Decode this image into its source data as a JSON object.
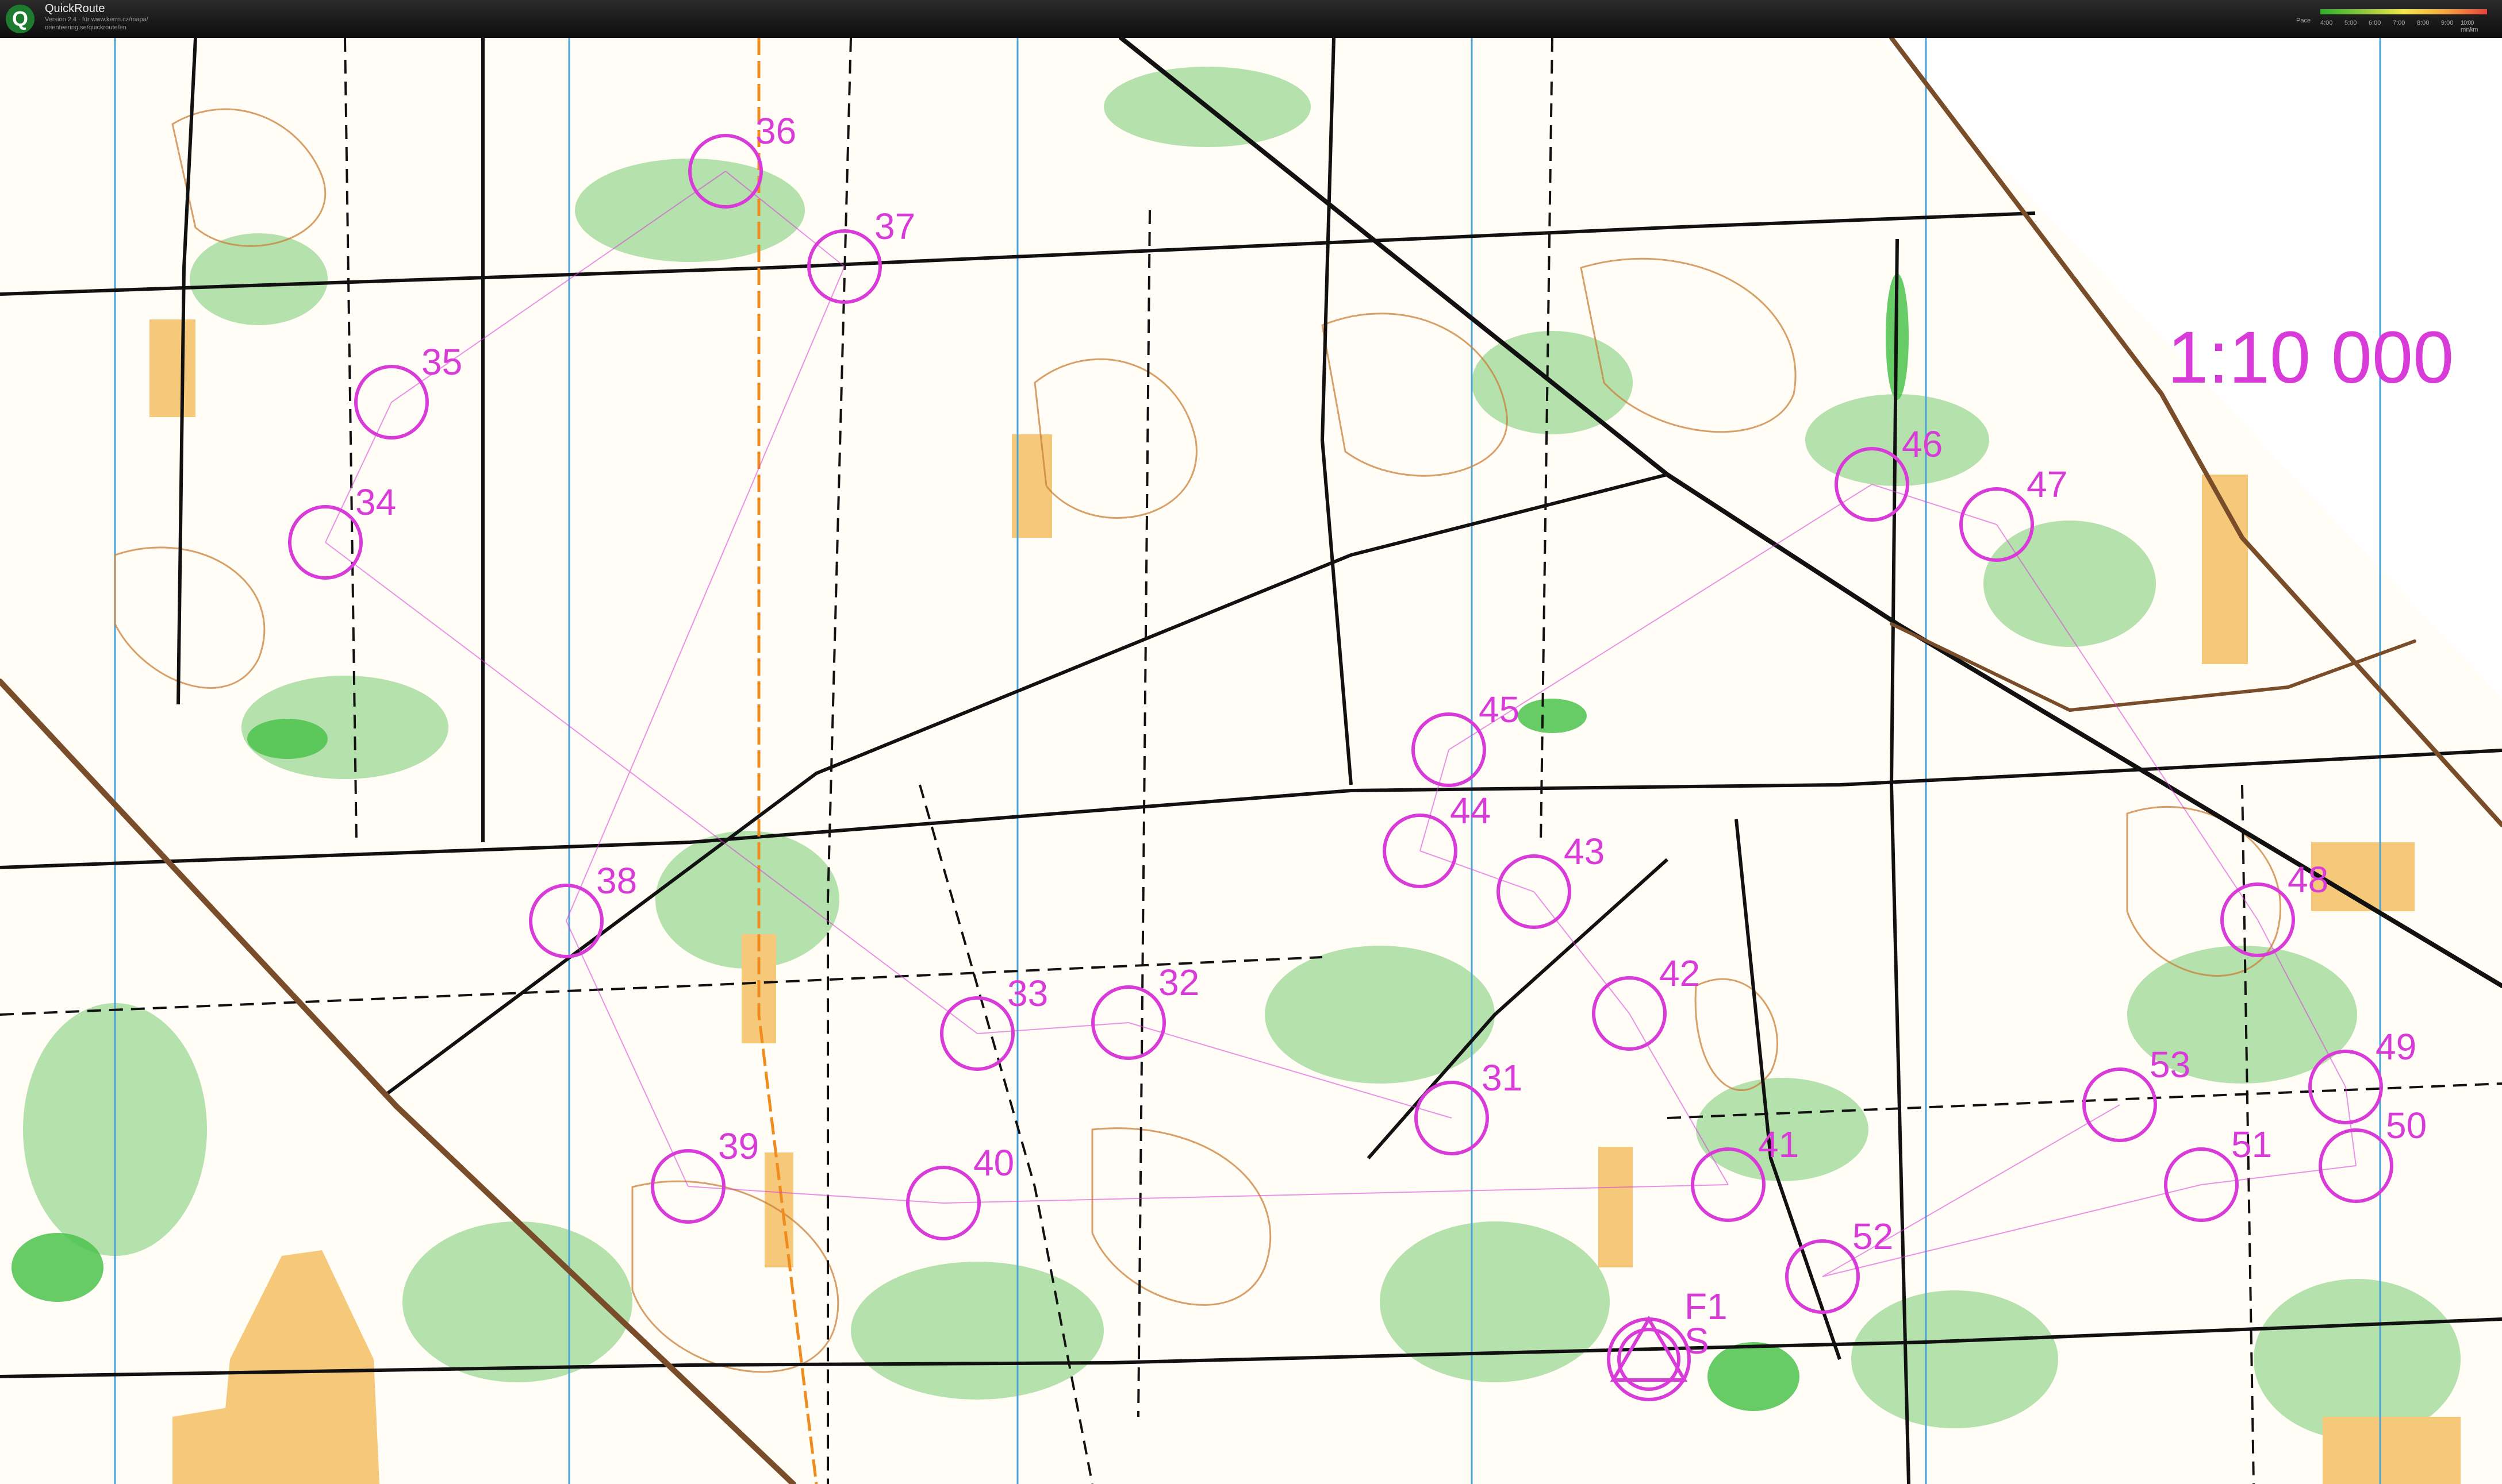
{
  "app": {
    "icon_letter": "Q",
    "title": "QuickRoute",
    "subtitle_lines": [
      "Version 2.4 · für www.kerrn.cz/mapa/",
      "orienteering.se/quickroute/en"
    ]
  },
  "pace_legend": {
    "label": "Pace",
    "ticks": [
      "4:00",
      "5:00",
      "6:00",
      "7:00",
      "8:00",
      "9:00",
      "10:00 min/km"
    ],
    "colors": [
      "#2db02d",
      "#8cc63f",
      "#f4e84a",
      "#f5a742",
      "#e8433c"
    ]
  },
  "map": {
    "scale_text": "1:10 000",
    "course_color": "#d93bd9",
    "controls": [
      {
        "number": "31"
      },
      {
        "number": "32"
      },
      {
        "number": "33"
      },
      {
        "number": "34"
      },
      {
        "number": "35"
      },
      {
        "number": "36"
      },
      {
        "number": "37"
      },
      {
        "number": "38"
      },
      {
        "number": "39"
      },
      {
        "number": "40"
      },
      {
        "number": "41"
      },
      {
        "number": "42"
      },
      {
        "number": "43"
      },
      {
        "number": "44"
      },
      {
        "number": "45"
      },
      {
        "number": "46"
      },
      {
        "number": "47"
      },
      {
        "number": "48"
      },
      {
        "number": "49"
      },
      {
        "number": "50"
      },
      {
        "number": "51"
      },
      {
        "number": "52"
      },
      {
        "number": "53"
      }
    ],
    "start_finish_labels": [
      "S",
      "F1"
    ]
  }
}
